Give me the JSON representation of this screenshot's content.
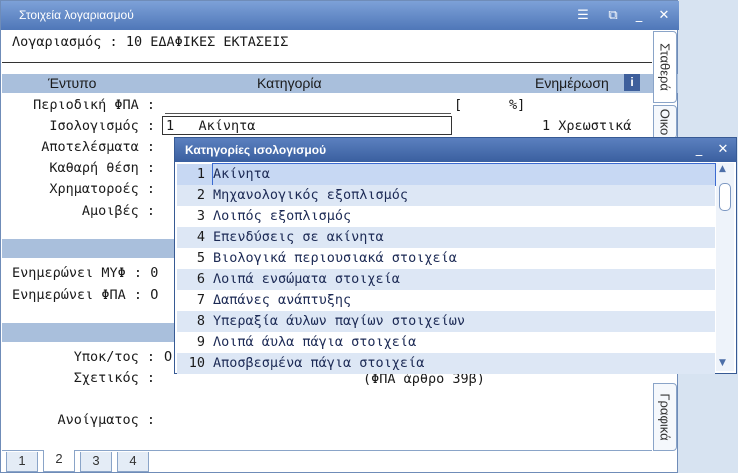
{
  "window": {
    "title": "Στοιχεία λογαριασμού",
    "icons": [
      "list-icon",
      "popout-icon",
      "minimize-icon",
      "close-icon"
    ]
  },
  "account": {
    "label": "Λογαριασμός :",
    "code": "10",
    "name": "ΕΔΑΦΙΚΕΣ ΕΚΤΑΣΕΙΣ"
  },
  "header": {
    "col1": "Έντυπο",
    "col2": "Κατηγορία",
    "col3": "Ενημέρωση",
    "info_icon": "i"
  },
  "forms": {
    "periodic_vat": {
      "label": "Περιοδική ΦΠΑ :",
      "bracket_open": "[",
      "percent": "%]"
    },
    "balance": {
      "label": "Ισολογισμός :",
      "value_code": "1",
      "value_name": "Ακίνητα",
      "update": "1 Χρεωστικά"
    },
    "results": {
      "label": "Αποτελέσματα :"
    },
    "net_position": {
      "label": "Καθαρή θέση :"
    },
    "cash_flows": {
      "label": "Χρηματοροές :"
    },
    "fees": {
      "label": "Αμοιβές :"
    }
  },
  "updates": {
    "myf": {
      "label": "Ενημερώνει ΜΥΦ :",
      "value": "0"
    },
    "vat": {
      "label": "Ενημερώνει ΦΠΑ :",
      "value": "O"
    }
  },
  "bottom": {
    "subaccount": {
      "label": "Υποκ/τος :",
      "value": "O"
    },
    "related": {
      "label": "Σχετικός :",
      "note": "(ΦΠΑ άρθρο 39β)"
    },
    "opening": {
      "label": "Ανοίγματος :"
    }
  },
  "side_tabs": [
    "Σταθερά",
    "Οικο",
    "Γραφικά"
  ],
  "bottom_tabs": [
    "1",
    "2",
    "3",
    "4"
  ],
  "popup": {
    "title": "Κατηγορίες ισολογισμού",
    "items": [
      {
        "n": "1",
        "text": "Ακίνητα"
      },
      {
        "n": "2",
        "text": "Μηχανολογικός εξοπλισμός"
      },
      {
        "n": "3",
        "text": "Λοιπός εξοπλισμός"
      },
      {
        "n": "4",
        "text": "Επενδύσεις σε ακίνητα"
      },
      {
        "n": "5",
        "text": "Βιολογικά περιουσιακά στοιχεία"
      },
      {
        "n": "6",
        "text": "Λοιπά ενσώματα στοιχεία"
      },
      {
        "n": "7",
        "text": "Δαπάνες ανάπτυξης"
      },
      {
        "n": "8",
        "text": "Υπεραξία άυλων παγίων στοιχείων"
      },
      {
        "n": "9",
        "text": "Λοιπά άυλα πάγια στοιχεία"
      },
      {
        "n": "10",
        "text": "Αποσβεσμένα πάγια στοιχεία"
      }
    ]
  },
  "colors": {
    "titlebar": "#5a80c0",
    "band": "#a9bfdc",
    "selection": "#c7d8f3"
  }
}
